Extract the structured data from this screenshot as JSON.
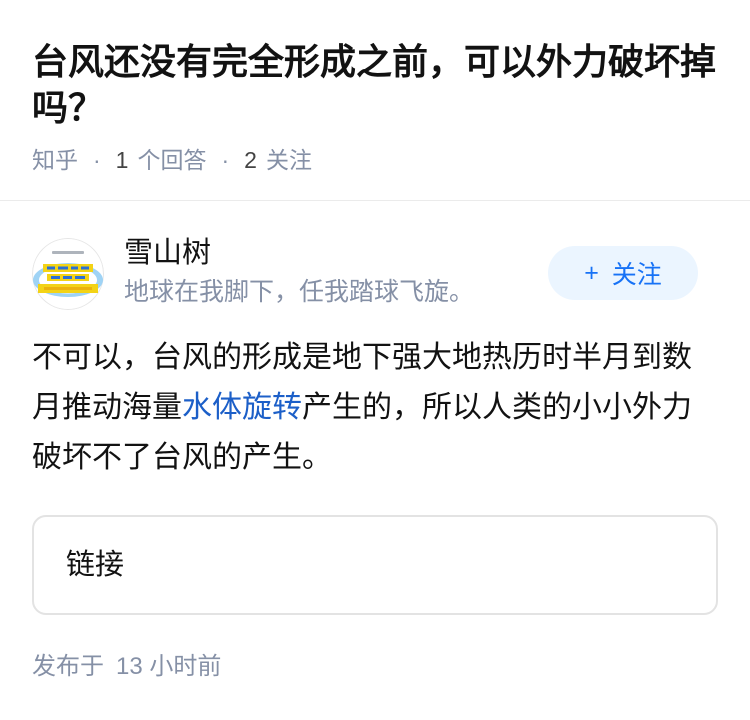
{
  "question": {
    "title": "台风还没有完全形成之前，可以外力破坏掉吗？",
    "meta": {
      "source": "知乎",
      "separator": "·",
      "answer_count": "1",
      "answer_label": "个回答",
      "follower_count": "2",
      "follower_label": "关注"
    }
  },
  "answer": {
    "author": {
      "name": "雪山树",
      "bio": "地球在我脚下，任我踏球飞旋。",
      "avatar_icon": "avatar"
    },
    "follow_button": {
      "icon": "plus-icon",
      "plus": "+",
      "label": "关注"
    },
    "content": {
      "before_link": "不可以，台风的形成是地下强大地热历时半月到数月推动海量",
      "link_text": "水体旋转",
      "after_link": "产生的，所以人类的小小外力破坏不了台风的产生。"
    },
    "link_card": {
      "label": "链接"
    },
    "published": {
      "label": "发布于",
      "time": "13 小时前"
    }
  },
  "colors": {
    "text_primary": "#121212",
    "text_secondary": "#8590a6",
    "link": "#1c5fc8",
    "follow_text": "#1772f6",
    "follow_background": "#ebf5ff",
    "avatar_yellow": "#f3d316",
    "avatar_blue": "#9fd3f5"
  }
}
